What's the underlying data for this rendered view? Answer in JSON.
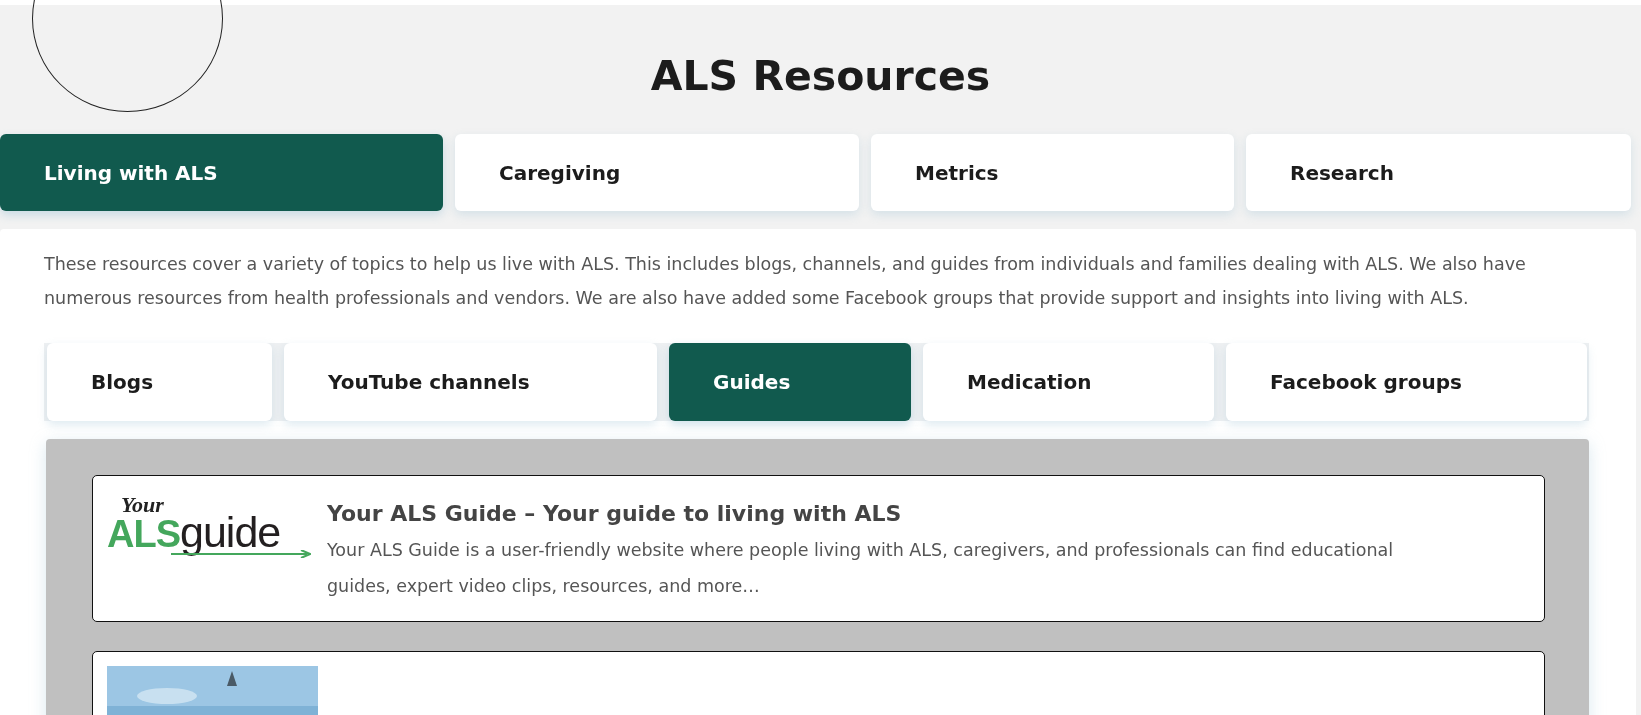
{
  "title": "ALS Resources",
  "tabs": [
    {
      "label": "Living with ALS",
      "selected": true
    },
    {
      "label": "Caregiving",
      "selected": false
    },
    {
      "label": "Metrics",
      "selected": false
    },
    {
      "label": "Research",
      "selected": false
    }
  ],
  "intro": "These resources cover a variety of topics to help us live with ALS. This includes blogs, channels, and guides from individuals and families dealing with ALS. We also have numerous resources from health professionals and vendors. We are also have added some Facebook groups that provide support and insights into living with ALS.",
  "subtabs": [
    {
      "label": "Blogs",
      "selected": false
    },
    {
      "label": "YouTube channels",
      "selected": false
    },
    {
      "label": "Guides",
      "selected": true
    },
    {
      "label": "Medication",
      "selected": false
    },
    {
      "label": "Facebook groups",
      "selected": false
    }
  ],
  "resources": [
    {
      "kind": "logo",
      "logo": {
        "script": "Your",
        "accent": "ALS",
        "main": "guide"
      },
      "title": "Your ALS Guide – Your guide to living with ALS",
      "description": "Your ALS Guide is a user-friendly website where people living with ALS, caregivers, and professionals can find educational guides, expert video clips, resources, and more…"
    },
    {
      "kind": "picture"
    }
  ]
}
